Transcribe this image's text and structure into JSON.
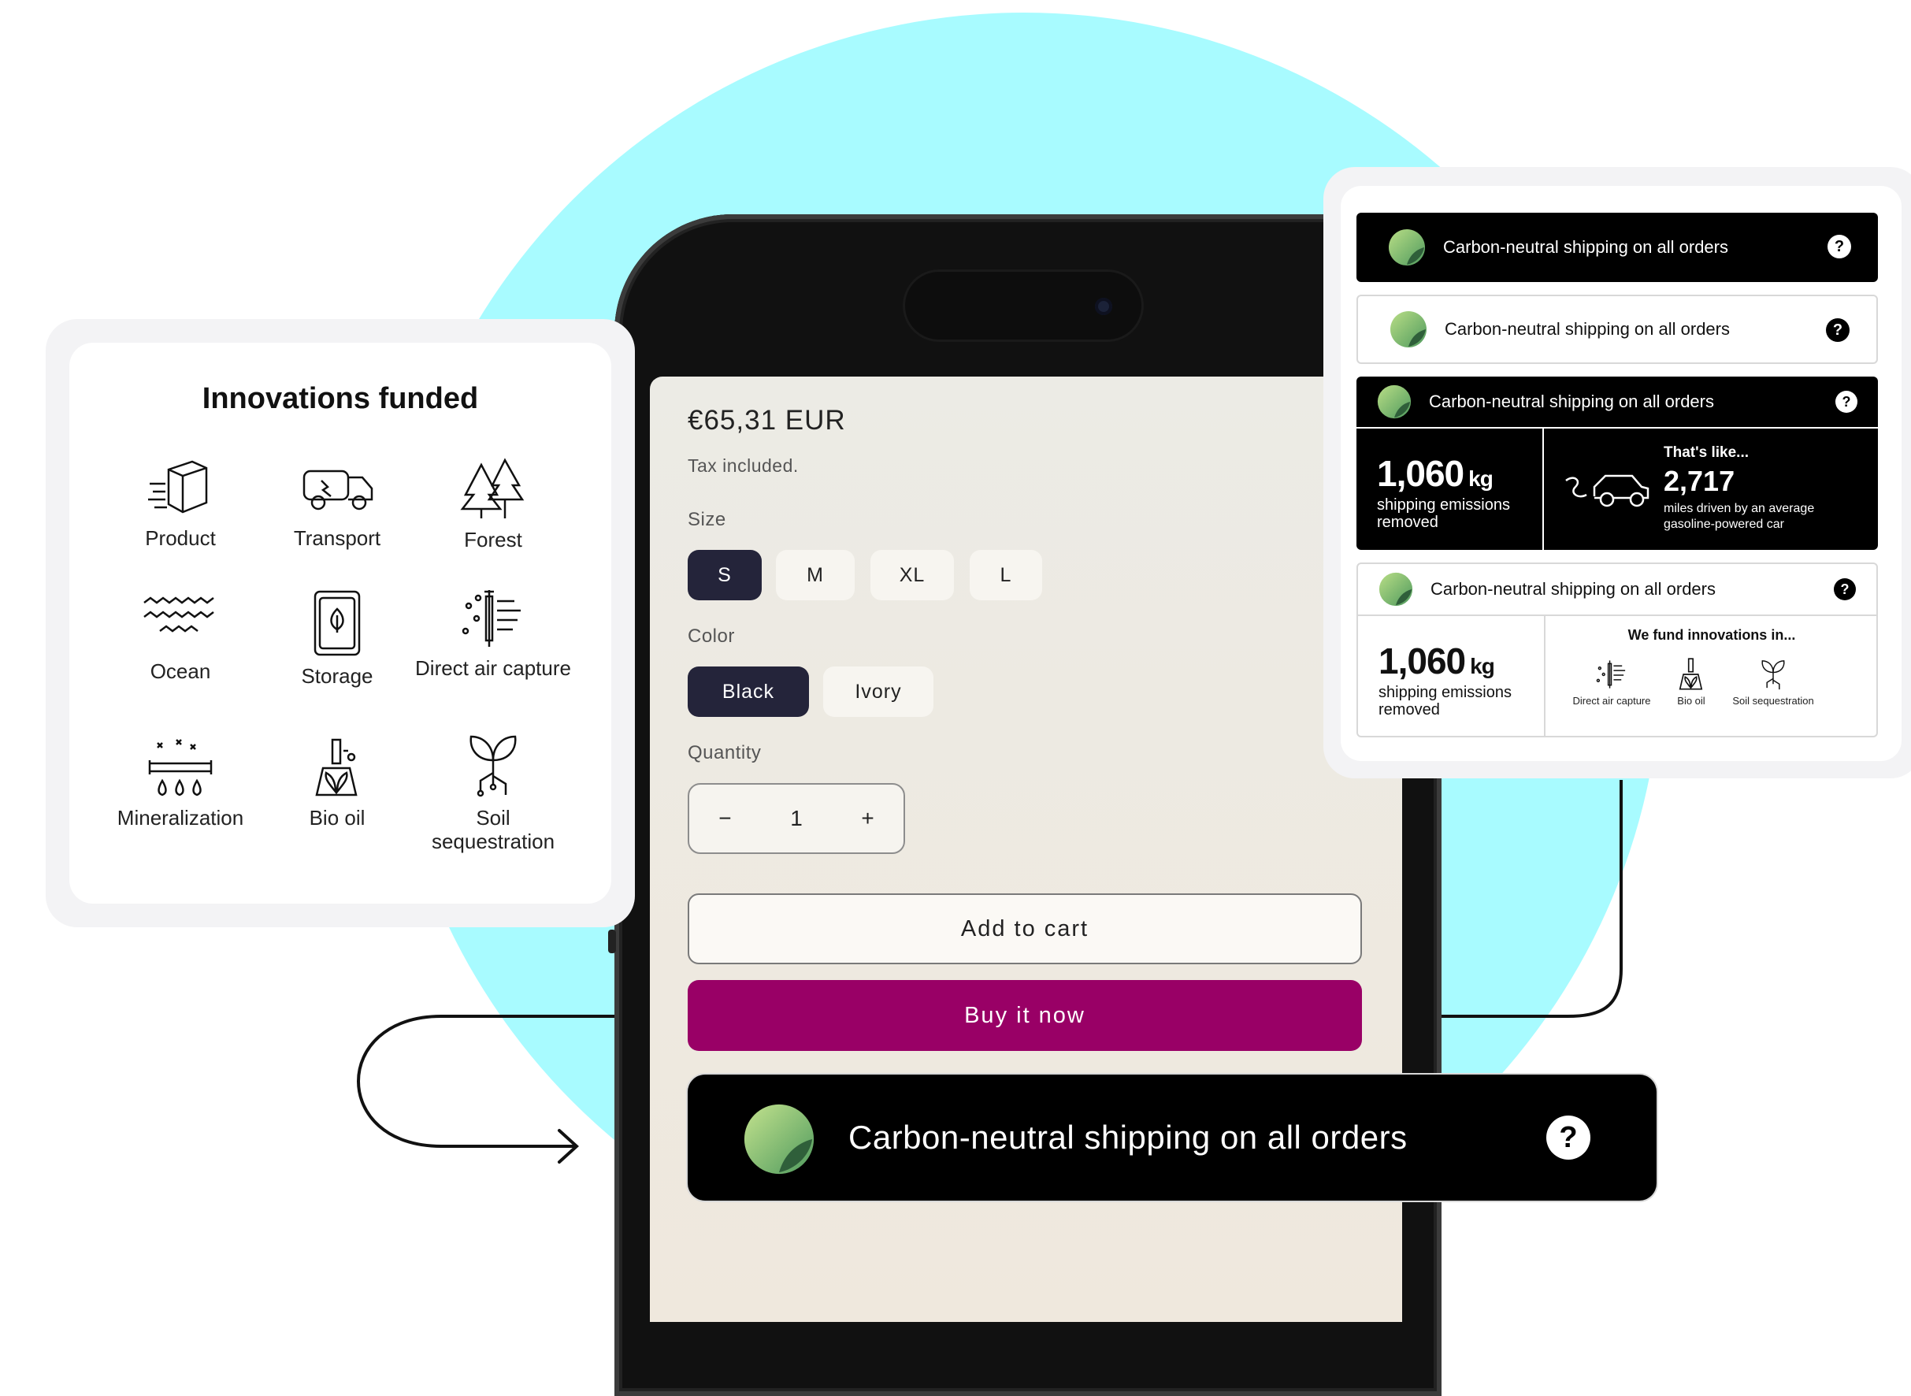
{
  "colors": {
    "circle": "#a8fbff",
    "buy_button": "#990066",
    "selected_chip": "#24243a",
    "banner": "#000000"
  },
  "product": {
    "price": "€65,31 EUR",
    "tax_note": "Tax included.",
    "size_label": "Size",
    "sizes": [
      "S",
      "M",
      "XL",
      "L"
    ],
    "selected_size": "S",
    "color_label": "Color",
    "colors": [
      "Black",
      "Ivory"
    ],
    "selected_color": "Black",
    "quantity_label": "Quantity",
    "quantity_minus": "−",
    "quantity_value": "1",
    "quantity_plus": "+",
    "add_to_cart": "Add to cart",
    "buy_now": "Buy it now"
  },
  "innovations": {
    "title": "Innovations funded",
    "items": [
      {
        "label": "Product",
        "icon": "box-icon"
      },
      {
        "label": "Transport",
        "icon": "truck-icon"
      },
      {
        "label": "Forest",
        "icon": "trees-icon"
      },
      {
        "label": "Ocean",
        "icon": "waves-icon"
      },
      {
        "label": "Storage",
        "icon": "storage-bag-icon"
      },
      {
        "label": "Direct air capture",
        "icon": "air-capture-icon"
      },
      {
        "label": "Mineralization",
        "icon": "mineralization-icon"
      },
      {
        "label": "Bio oil",
        "icon": "bio-oil-icon"
      },
      {
        "label": "Soil sequestration",
        "icon": "sprout-icon"
      }
    ]
  },
  "widgets": {
    "bar_text": "Carbon-neutral shipping on all orders",
    "help": "?",
    "emissions_value": "1,060",
    "emissions_unit": "kg",
    "emissions_caption": "shipping emissions removed",
    "like_title": "That's like...",
    "like_value": "2,717",
    "like_caption": "miles driven by an average gasoline-powered car",
    "fund_title": "We fund innovations in...",
    "fund_items": [
      "Direct air capture",
      "Bio oil",
      "Soil sequestration"
    ]
  },
  "banner": {
    "text": "Carbon-neutral shipping on all orders",
    "help": "?"
  }
}
